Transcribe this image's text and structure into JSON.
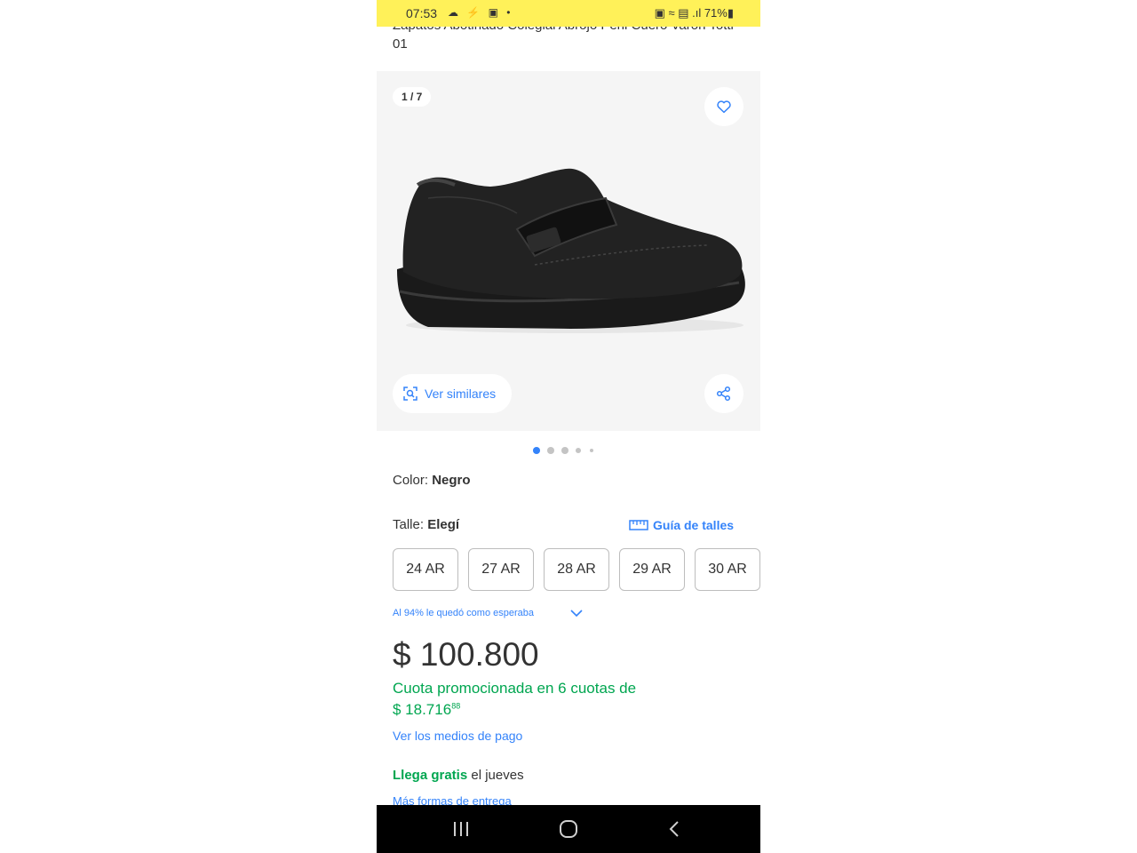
{
  "status_bar": {
    "time": "07:53",
    "left_icons": "☁ ⚡ ▣ •",
    "right_text": "▣ ≈ ▤ .ıl 71%▮"
  },
  "product": {
    "title": "Zapatos Abotinado Colegial Abrojo Peni Cuero Varon Totti 01",
    "gallery": {
      "counter": "1 / 7",
      "similar_label": "Ver similares",
      "active_dot": 0,
      "dot_count": 5
    },
    "color": {
      "label": "Color:",
      "value": "Negro"
    },
    "size": {
      "label": "Talle:",
      "value": "Elegí",
      "guide_label": "Guía de talles",
      "options": [
        "24 AR",
        "27 AR",
        "28 AR",
        "29 AR",
        "30 AR"
      ]
    },
    "fit_note": "Al 94% le quedó como esperaba",
    "price": "$ 100.800",
    "installments_line1": "Cuota promocionada en 6 cuotas de",
    "installments_amount": "$ 18.716",
    "installments_cents": "88",
    "payment_link": "Ver los medios de pago",
    "shipping": {
      "free": "Llega gratis",
      "when": "el jueves",
      "more_link": "Más formas de entrega"
    }
  },
  "colors": {
    "status_bar_bg": "#fff159",
    "accent_blue": "#3483fa",
    "green": "#00a650",
    "gallery_bg": "#f5f5f5"
  },
  "icons": [
    "heart-icon",
    "visual-search-icon",
    "share-icon",
    "ruler-icon",
    "chevron-down-icon",
    "recent-apps-icon",
    "home-icon",
    "back-icon"
  ]
}
